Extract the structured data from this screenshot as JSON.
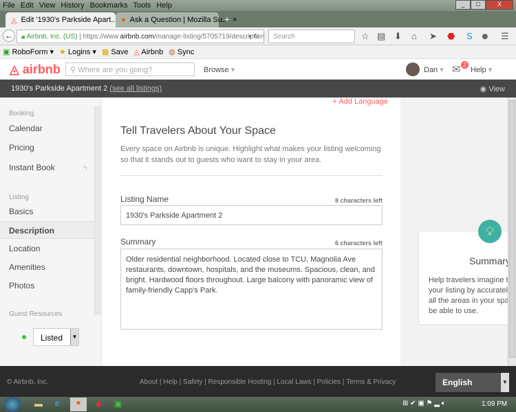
{
  "browser": {
    "menu": [
      "File",
      "Edit",
      "View",
      "History",
      "Bookmarks",
      "Tools",
      "Help"
    ],
    "tabs": [
      {
        "label": "Edit '1930's Parkside Apart..."
      },
      {
        "label": "Ask a Question | Mozilla Su..."
      }
    ],
    "identity": "Airbnb, Inc. (US)",
    "url_prefix": "https://www.",
    "url_domain": "airbnb.com",
    "url_path": "/manage-listing/5705719/description",
    "search_placeholder": "Search",
    "bookmarks": [
      "RoboForm",
      "Logins",
      "Save",
      "Airbnb",
      "Sync"
    ]
  },
  "header": {
    "logo": "airbnb",
    "search_placeholder": "Where are you going?",
    "browse": "Browse",
    "user": "Dan",
    "messages_badge": "2",
    "help": "Help"
  },
  "subbar": {
    "listing": "1930's Parkside Apartment 2",
    "see_all": "(see all listings)",
    "view": "View"
  },
  "sidebar": {
    "booking_heading": "Booking",
    "booking": [
      "Calendar",
      "Pricing",
      "Instant Book"
    ],
    "listing_heading": "Listing",
    "listing": [
      "Basics",
      "Description",
      "Location",
      "Amenities",
      "Photos"
    ],
    "guest_heading": "Guest Resources",
    "status": "Listed"
  },
  "main": {
    "add_language": "Add Language",
    "title": "Tell Travelers About Your Space",
    "intro": "Every space on Airbnb is unique. Highlight what makes your listing welcoming so that it stands out to guests who want to stay in your area.",
    "name_label": "Listing Name",
    "name_left": "8 characters left",
    "name_value": "1930's Parkside Apartment 2",
    "summary_label": "Summary",
    "summary_left": "6 characters left",
    "summary_value": "Older residential neighborhood.  Located close to TCU, Magnolia Ave restaurants, downtown, hospitals, and the museums.  Spacious, clean, and bright.  Hardwood floors throughout.  Large balcony with panoramic view of family-friendly Capp's Park."
  },
  "tip": {
    "title": "Summary",
    "text": "Help travelers imagine the your listing by accurately all the areas in your space be able to use."
  },
  "footer": {
    "copyright": "© Airbnb, Inc.",
    "links": [
      "About",
      "Help",
      "Safety",
      "Responsible Hosting",
      "Local Laws",
      "Policies",
      "Terms & Privacy"
    ],
    "language": "English"
  },
  "taskbar": {
    "time": "1:09 PM"
  },
  "colors": {
    "brand": "#ff5a5f",
    "teal": "#3fb0a3"
  }
}
